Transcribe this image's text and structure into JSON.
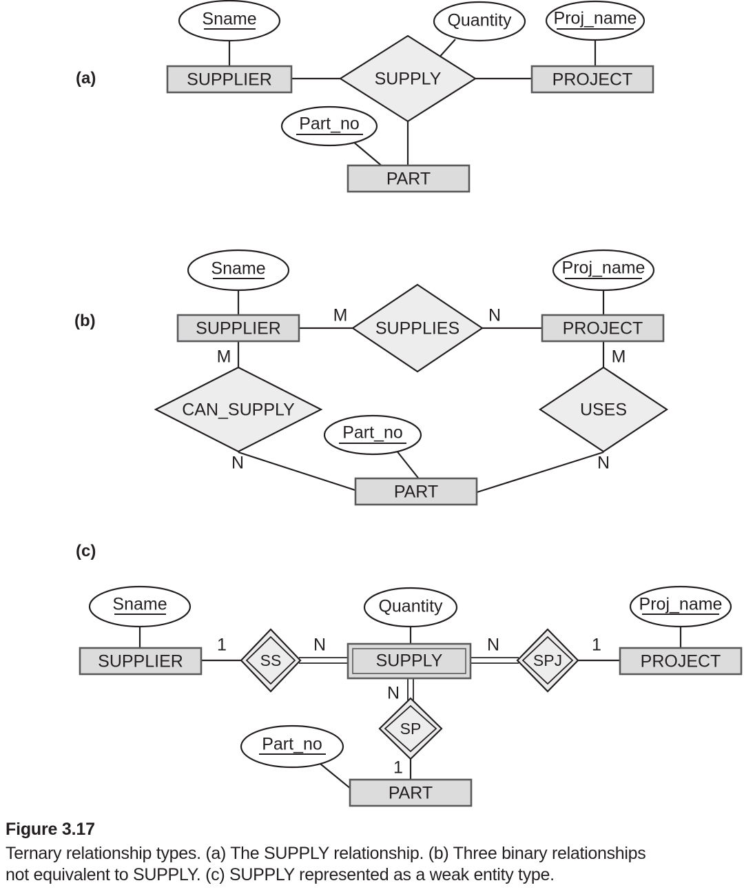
{
  "figure": {
    "number_label": "Figure 3.17",
    "caption_line_1": "Ternary relationship types. (a) The SUPPLY relationship. (b) Three binary relationships",
    "caption_line_2": "not equivalent to SUPPLY. (c) SUPPLY represented as a weak entity type."
  },
  "part_labels": {
    "a": "(a)",
    "b": "(b)",
    "c": "(c)"
  },
  "colors": {
    "entity_fill": "#dcdcdc",
    "entity_stroke": "#58595b",
    "relationship_fill": "#ededed",
    "line_stroke": "#231f20",
    "attribute_fill": "#ffffff",
    "background": "#ffffff"
  },
  "part_a": {
    "title": "The SUPPLY relationship",
    "entities": [
      {
        "id": "supplier",
        "label": "SUPPLIER",
        "weak": false
      },
      {
        "id": "project",
        "label": "PROJECT",
        "weak": false
      },
      {
        "id": "part",
        "label": "PART",
        "weak": false
      }
    ],
    "relationships": [
      {
        "id": "supply",
        "label": "SUPPLY",
        "identifying": false,
        "degree": 3
      }
    ],
    "attributes": [
      {
        "id": "sname",
        "label": "Sname",
        "key": true,
        "owner": "supplier"
      },
      {
        "id": "quantity",
        "label": "Quantity",
        "key": false,
        "owner": "supply"
      },
      {
        "id": "proj_name",
        "label": "Proj_name",
        "key": true,
        "owner": "project"
      },
      {
        "id": "part_no",
        "label": "Part_no",
        "key": true,
        "owner": "part"
      }
    ],
    "edges": [
      {
        "from": "supplier",
        "to": "supply",
        "cardinality": ""
      },
      {
        "from": "supply",
        "to": "project",
        "cardinality": ""
      },
      {
        "from": "supply",
        "to": "part",
        "cardinality": ""
      }
    ]
  },
  "part_b": {
    "title": "Three binary relationships not equivalent to SUPPLY",
    "entities": [
      {
        "id": "supplier",
        "label": "SUPPLIER",
        "weak": false
      },
      {
        "id": "project",
        "label": "PROJECT",
        "weak": false
      },
      {
        "id": "part",
        "label": "PART",
        "weak": false
      }
    ],
    "relationships": [
      {
        "id": "supplies",
        "label": "SUPPLIES",
        "identifying": false
      },
      {
        "id": "can_supply",
        "label": "CAN_SUPPLY",
        "identifying": false
      },
      {
        "id": "uses",
        "label": "USES",
        "identifying": false
      }
    ],
    "attributes": [
      {
        "id": "sname",
        "label": "Sname",
        "key": true,
        "owner": "supplier"
      },
      {
        "id": "proj_name",
        "label": "Proj_name",
        "key": true,
        "owner": "project"
      },
      {
        "id": "part_no",
        "label": "Part_no",
        "key": true,
        "owner": "part"
      }
    ],
    "edges": [
      {
        "from": "supplier",
        "to": "supplies",
        "cardinality": "M"
      },
      {
        "from": "supplies",
        "to": "project",
        "cardinality": "N"
      },
      {
        "from": "supplier",
        "to": "can_supply",
        "cardinality": "M"
      },
      {
        "from": "can_supply",
        "to": "part",
        "cardinality": "N"
      },
      {
        "from": "project",
        "to": "uses",
        "cardinality": "M"
      },
      {
        "from": "uses",
        "to": "part",
        "cardinality": "N"
      }
    ],
    "cardinality_labels": {
      "supplier_supplies": "M",
      "supplies_project": "N",
      "supplier_can_supply": "M",
      "can_supply_part": "N",
      "project_uses": "M",
      "uses_part": "N"
    }
  },
  "part_c": {
    "title": "SUPPLY represented as a weak entity type",
    "entities": [
      {
        "id": "supplier",
        "label": "SUPPLIER",
        "weak": false
      },
      {
        "id": "supply",
        "label": "SUPPLY",
        "weak": true
      },
      {
        "id": "project",
        "label": "PROJECT",
        "weak": false
      },
      {
        "id": "part",
        "label": "PART",
        "weak": false
      }
    ],
    "relationships": [
      {
        "id": "ss",
        "label": "SS",
        "identifying": true
      },
      {
        "id": "spj",
        "label": "SPJ",
        "identifying": true
      },
      {
        "id": "sp",
        "label": "SP",
        "identifying": true
      }
    ],
    "attributes": [
      {
        "id": "sname",
        "label": "Sname",
        "key": true,
        "owner": "supplier"
      },
      {
        "id": "quantity",
        "label": "Quantity",
        "key": false,
        "owner": "supply"
      },
      {
        "id": "proj_name",
        "label": "Proj_name",
        "key": true,
        "owner": "project"
      },
      {
        "id": "part_no",
        "label": "Part_no",
        "key": true,
        "owner": "part"
      }
    ],
    "edges": [
      {
        "from": "supplier",
        "to": "ss",
        "cardinality": "1"
      },
      {
        "from": "ss",
        "to": "supply",
        "cardinality": "N"
      },
      {
        "from": "supply",
        "to": "spj",
        "cardinality": "N"
      },
      {
        "from": "spj",
        "to": "project",
        "cardinality": "1"
      },
      {
        "from": "supply",
        "to": "sp",
        "cardinality": "N"
      },
      {
        "from": "sp",
        "to": "part",
        "cardinality": "1"
      }
    ],
    "cardinality_labels": {
      "supplier_ss": "1",
      "ss_supply": "N",
      "supply_spj": "N",
      "spj_project": "1",
      "supply_sp": "N",
      "sp_part": "1"
    }
  }
}
